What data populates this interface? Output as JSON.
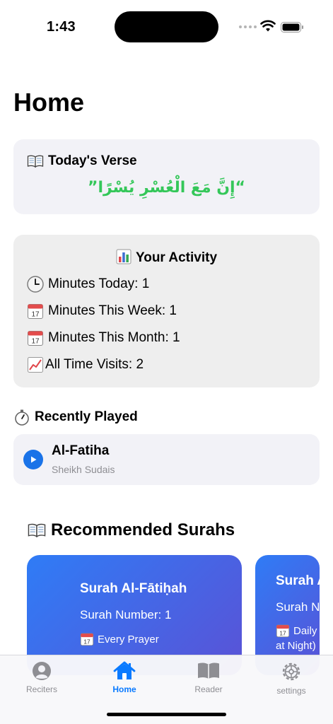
{
  "status": {
    "time": "1:43"
  },
  "page": {
    "title": "Home"
  },
  "verse": {
    "heading": "Today's Verse",
    "text": "“إِنَّ مَعَ الْعُسْرِ يُسْرًا”",
    "icon": "open-book-icon",
    "text_color": "#34c759"
  },
  "activity": {
    "heading": "Your Activity",
    "heading_icon": "bar-chart-icon",
    "rows": [
      {
        "icon": "clock-icon",
        "label": "Minutes Today: 1"
      },
      {
        "icon": "calendar-icon",
        "label": "Minutes This Week: 1"
      },
      {
        "icon": "calendar-icon",
        "label": "Minutes This Month: 1"
      },
      {
        "icon": "trend-chart-icon",
        "label": "All Time Visits: 2"
      }
    ]
  },
  "recent": {
    "heading": "Recently Played",
    "heading_icon": "stopwatch-icon",
    "item": {
      "title": "Al-Fatiha",
      "subtitle": "Sheikh Sudais"
    }
  },
  "recommended": {
    "heading": "Recommended Surahs",
    "heading_icon": "open-book-icon",
    "cards": [
      {
        "name": "Surah Al-Fātiḥah",
        "number": "Surah Number: 1",
        "when": "Every Prayer"
      },
      {
        "name": "Surah A",
        "number": "Surah N",
        "when": "Daily",
        "when2": "at Night)"
      }
    ],
    "gradient": [
      "#2f7cf6",
      "#5a52d6"
    ]
  },
  "tabs": [
    {
      "label": "Reciters",
      "icon": "person-circle-icon",
      "active": false
    },
    {
      "label": "Home",
      "icon": "house-icon",
      "active": true
    },
    {
      "label": "Reader",
      "icon": "book-icon",
      "active": false
    },
    {
      "label": "settings",
      "icon": "gear-icon",
      "active": false
    }
  ],
  "colors": {
    "accent": "#0a7aff",
    "play": "#1a73e8"
  }
}
